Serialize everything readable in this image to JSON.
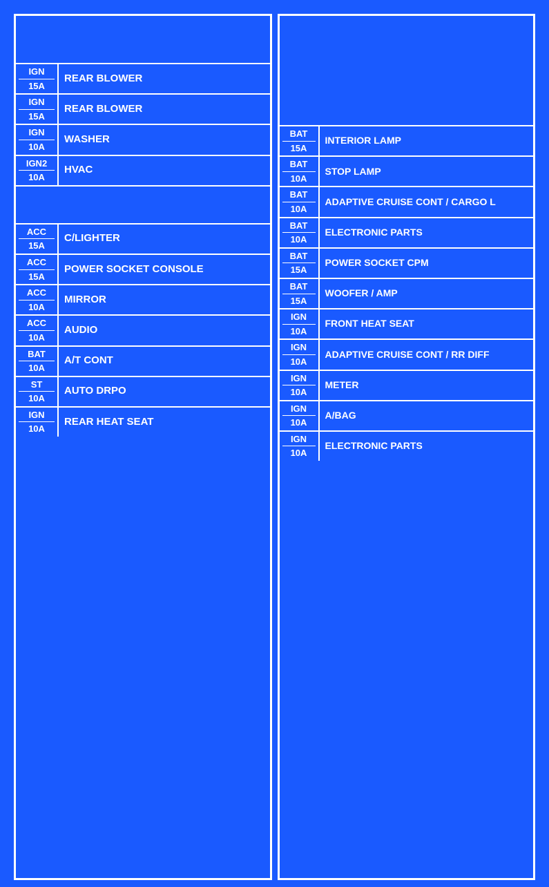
{
  "left_column": {
    "rows": [
      {
        "code_top": "IGN",
        "code_bottom": "15A",
        "label": "REAR BLOWER"
      },
      {
        "code_top": "IGN",
        "code_bottom": "15A",
        "label": "REAR BLOWER"
      },
      {
        "code_top": "IGN",
        "code_bottom": "10A",
        "label": "WASHER"
      },
      {
        "code_top": "IGN2",
        "code_bottom": "10A",
        "label": "HVAC"
      },
      {
        "type": "empty"
      },
      {
        "code_top": "ACC",
        "code_bottom": "15A",
        "label": "C/LIGHTER"
      },
      {
        "code_top": "ACC",
        "code_bottom": "15A",
        "label": "POWER SOCKET CONSOLE"
      },
      {
        "code_top": "ACC",
        "code_bottom": "10A",
        "label": "MIRROR"
      },
      {
        "code_top": "ACC",
        "code_bottom": "10A",
        "label": "AUDIO"
      },
      {
        "code_top": "BAT",
        "code_bottom": "10A",
        "label": "A/T CONT"
      },
      {
        "code_top": "ST",
        "code_bottom": "10A",
        "label": "AUTO DRPO"
      },
      {
        "code_top": "IGN",
        "code_bottom": "10A",
        "label": "REAR HEAT SEAT"
      }
    ]
  },
  "right_column": {
    "rows": [
      {
        "code_top": "BAT",
        "code_bottom": "15A",
        "label": "INTERIOR LAMP"
      },
      {
        "code_top": "BAT",
        "code_bottom": "10A",
        "label": "STOP LAMP"
      },
      {
        "code_top": "BAT",
        "code_bottom": "10A",
        "label": "ADAPTIVE CRUISE CONT / CARGO L"
      },
      {
        "code_top": "BAT",
        "code_bottom": "10A",
        "label": "ELECTRONIC PARTS"
      },
      {
        "code_top": "BAT",
        "code_bottom": "15A",
        "label": "POWER SOCKET CPM"
      },
      {
        "code_top": "BAT",
        "code_bottom": "15A",
        "label": "WOOFER / AMP"
      },
      {
        "code_top": "IGN",
        "code_bottom": "10A",
        "label": "FRONT HEAT SEAT"
      },
      {
        "code_top": "IGN",
        "code_bottom": "10A",
        "label": "ADAPTIVE CRUISE CONT / RR DIFF"
      },
      {
        "code_top": "IGN",
        "code_bottom": "10A",
        "label": "METER"
      },
      {
        "code_top": "IGN",
        "code_bottom": "10A",
        "label": "A/BAG"
      },
      {
        "code_top": "IGN",
        "code_bottom": "10A",
        "label": "ELECTRONIC PARTS"
      }
    ]
  }
}
